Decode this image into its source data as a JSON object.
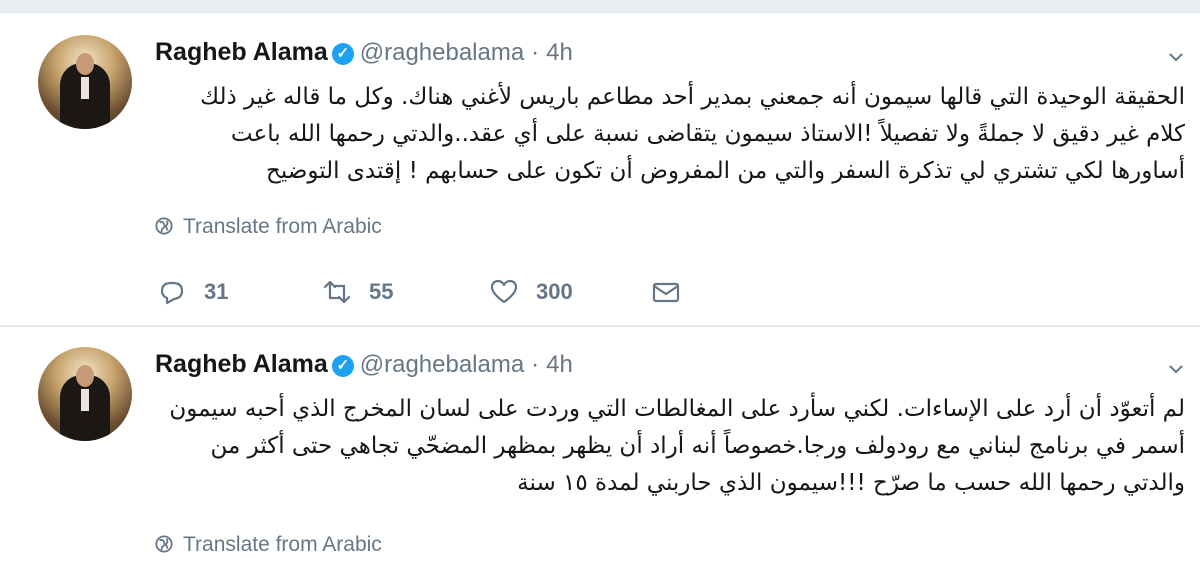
{
  "tweets": [
    {
      "author_name": "Ragheb Alama",
      "handle": "@raghebalama",
      "separator": "·",
      "time": "4h",
      "text": "الحقيقة الوحيدة التي قالها سيمون أنه جمعني بمدير أحد مطاعم باريس لأغني هناك. وكل ما قاله غير ذلك كلام غير دقيق لا جملةً ولا تفصيلاً !الاستاذ سيمون يتقاضى نسبة على أي عقد..والدتي رحمها الله باعت أساورها لكي تشتري لي تذكرة السفر والتي من المفروض أن تكون على حسابهم ! إقتدى التوضيح",
      "translate_label": "Translate from Arabic",
      "replies": "31",
      "retweets": "55",
      "likes": "300"
    },
    {
      "author_name": "Ragheb Alama",
      "handle": "@raghebalama",
      "separator": "·",
      "time": "4h",
      "text": "لم أتعوّد أن أرد على الإساءات. لكني سأرد على المغالطات التي وردت على لسان المخرج الذي أحبه سيمون أسمر في برنامج لبناني مع رودولف ورجا.خصوصاً أنه أراد أن يظهر بمظهر  المضحّي تجاهي حتى أكثر من والدتي رحمها الله حسب ما صرّح !!!سيمون الذي حاربني لمدة ١٥ سنة",
      "translate_label": "Translate from Arabic"
    }
  ],
  "colors": {
    "accent": "#1da1f2",
    "muted": "#657786",
    "text": "#14171a"
  },
  "icons": [
    "verified-badge-icon",
    "chevron-down-icon",
    "globe-icon",
    "reply-icon",
    "retweet-icon",
    "like-icon",
    "direct-message-icon"
  ]
}
